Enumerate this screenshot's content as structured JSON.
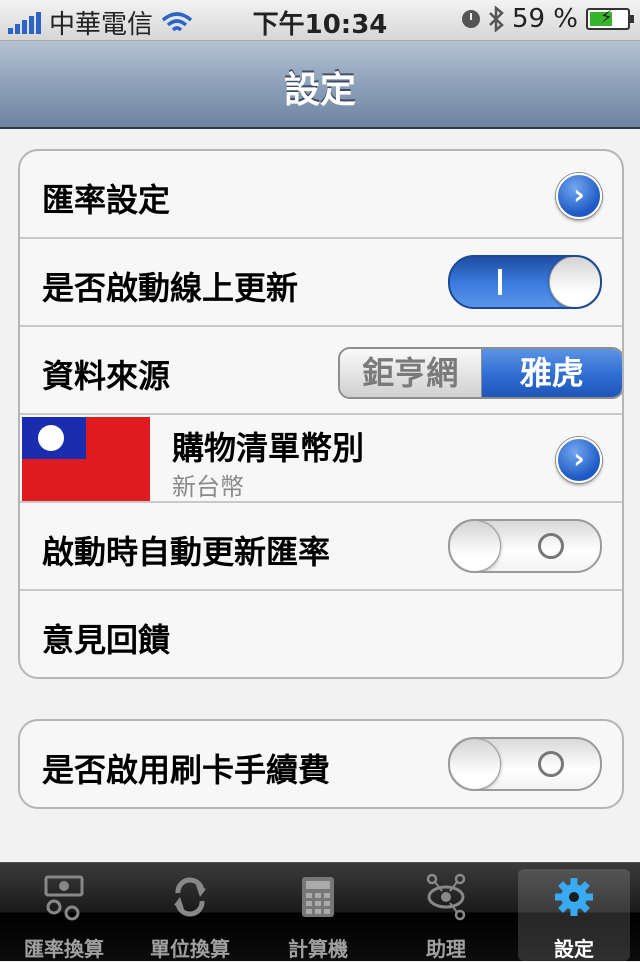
{
  "status_bar": {
    "carrier": "中華電信",
    "time": "下午10:34",
    "battery": "59 %"
  },
  "nav": {
    "title": "設定"
  },
  "group1": {
    "rate_settings": "匯率設定",
    "online_update": "是否啟動線上更新",
    "data_source": {
      "label": "資料來源",
      "options": [
        "鉅亨網",
        "雅虎"
      ],
      "selected": "雅虎"
    },
    "shopping_currency": {
      "title": "購物清單幣別",
      "value": "新台幣"
    },
    "auto_update": "啟動時自動更新匯率",
    "feedback": "意見回饋"
  },
  "group2": {
    "card_fee": "是否啟用刷卡手續費"
  },
  "toggles": {
    "online_update": true,
    "auto_update": false,
    "card_fee": false
  },
  "tabs": [
    {
      "label": "匯率換算",
      "icon": "currency-exchange-icon"
    },
    {
      "label": "單位換算",
      "icon": "refresh-icon"
    },
    {
      "label": "計算機",
      "icon": "calculator-icon"
    },
    {
      "label": "助理",
      "icon": "eye-network-icon"
    },
    {
      "label": "設定",
      "icon": "gear-icon"
    }
  ],
  "selected_tab": "設定",
  "colors": {
    "accent_blue": "#2f6dd3",
    "navbar": "#8ea1b9",
    "tabbar": "#1a1a1a"
  }
}
